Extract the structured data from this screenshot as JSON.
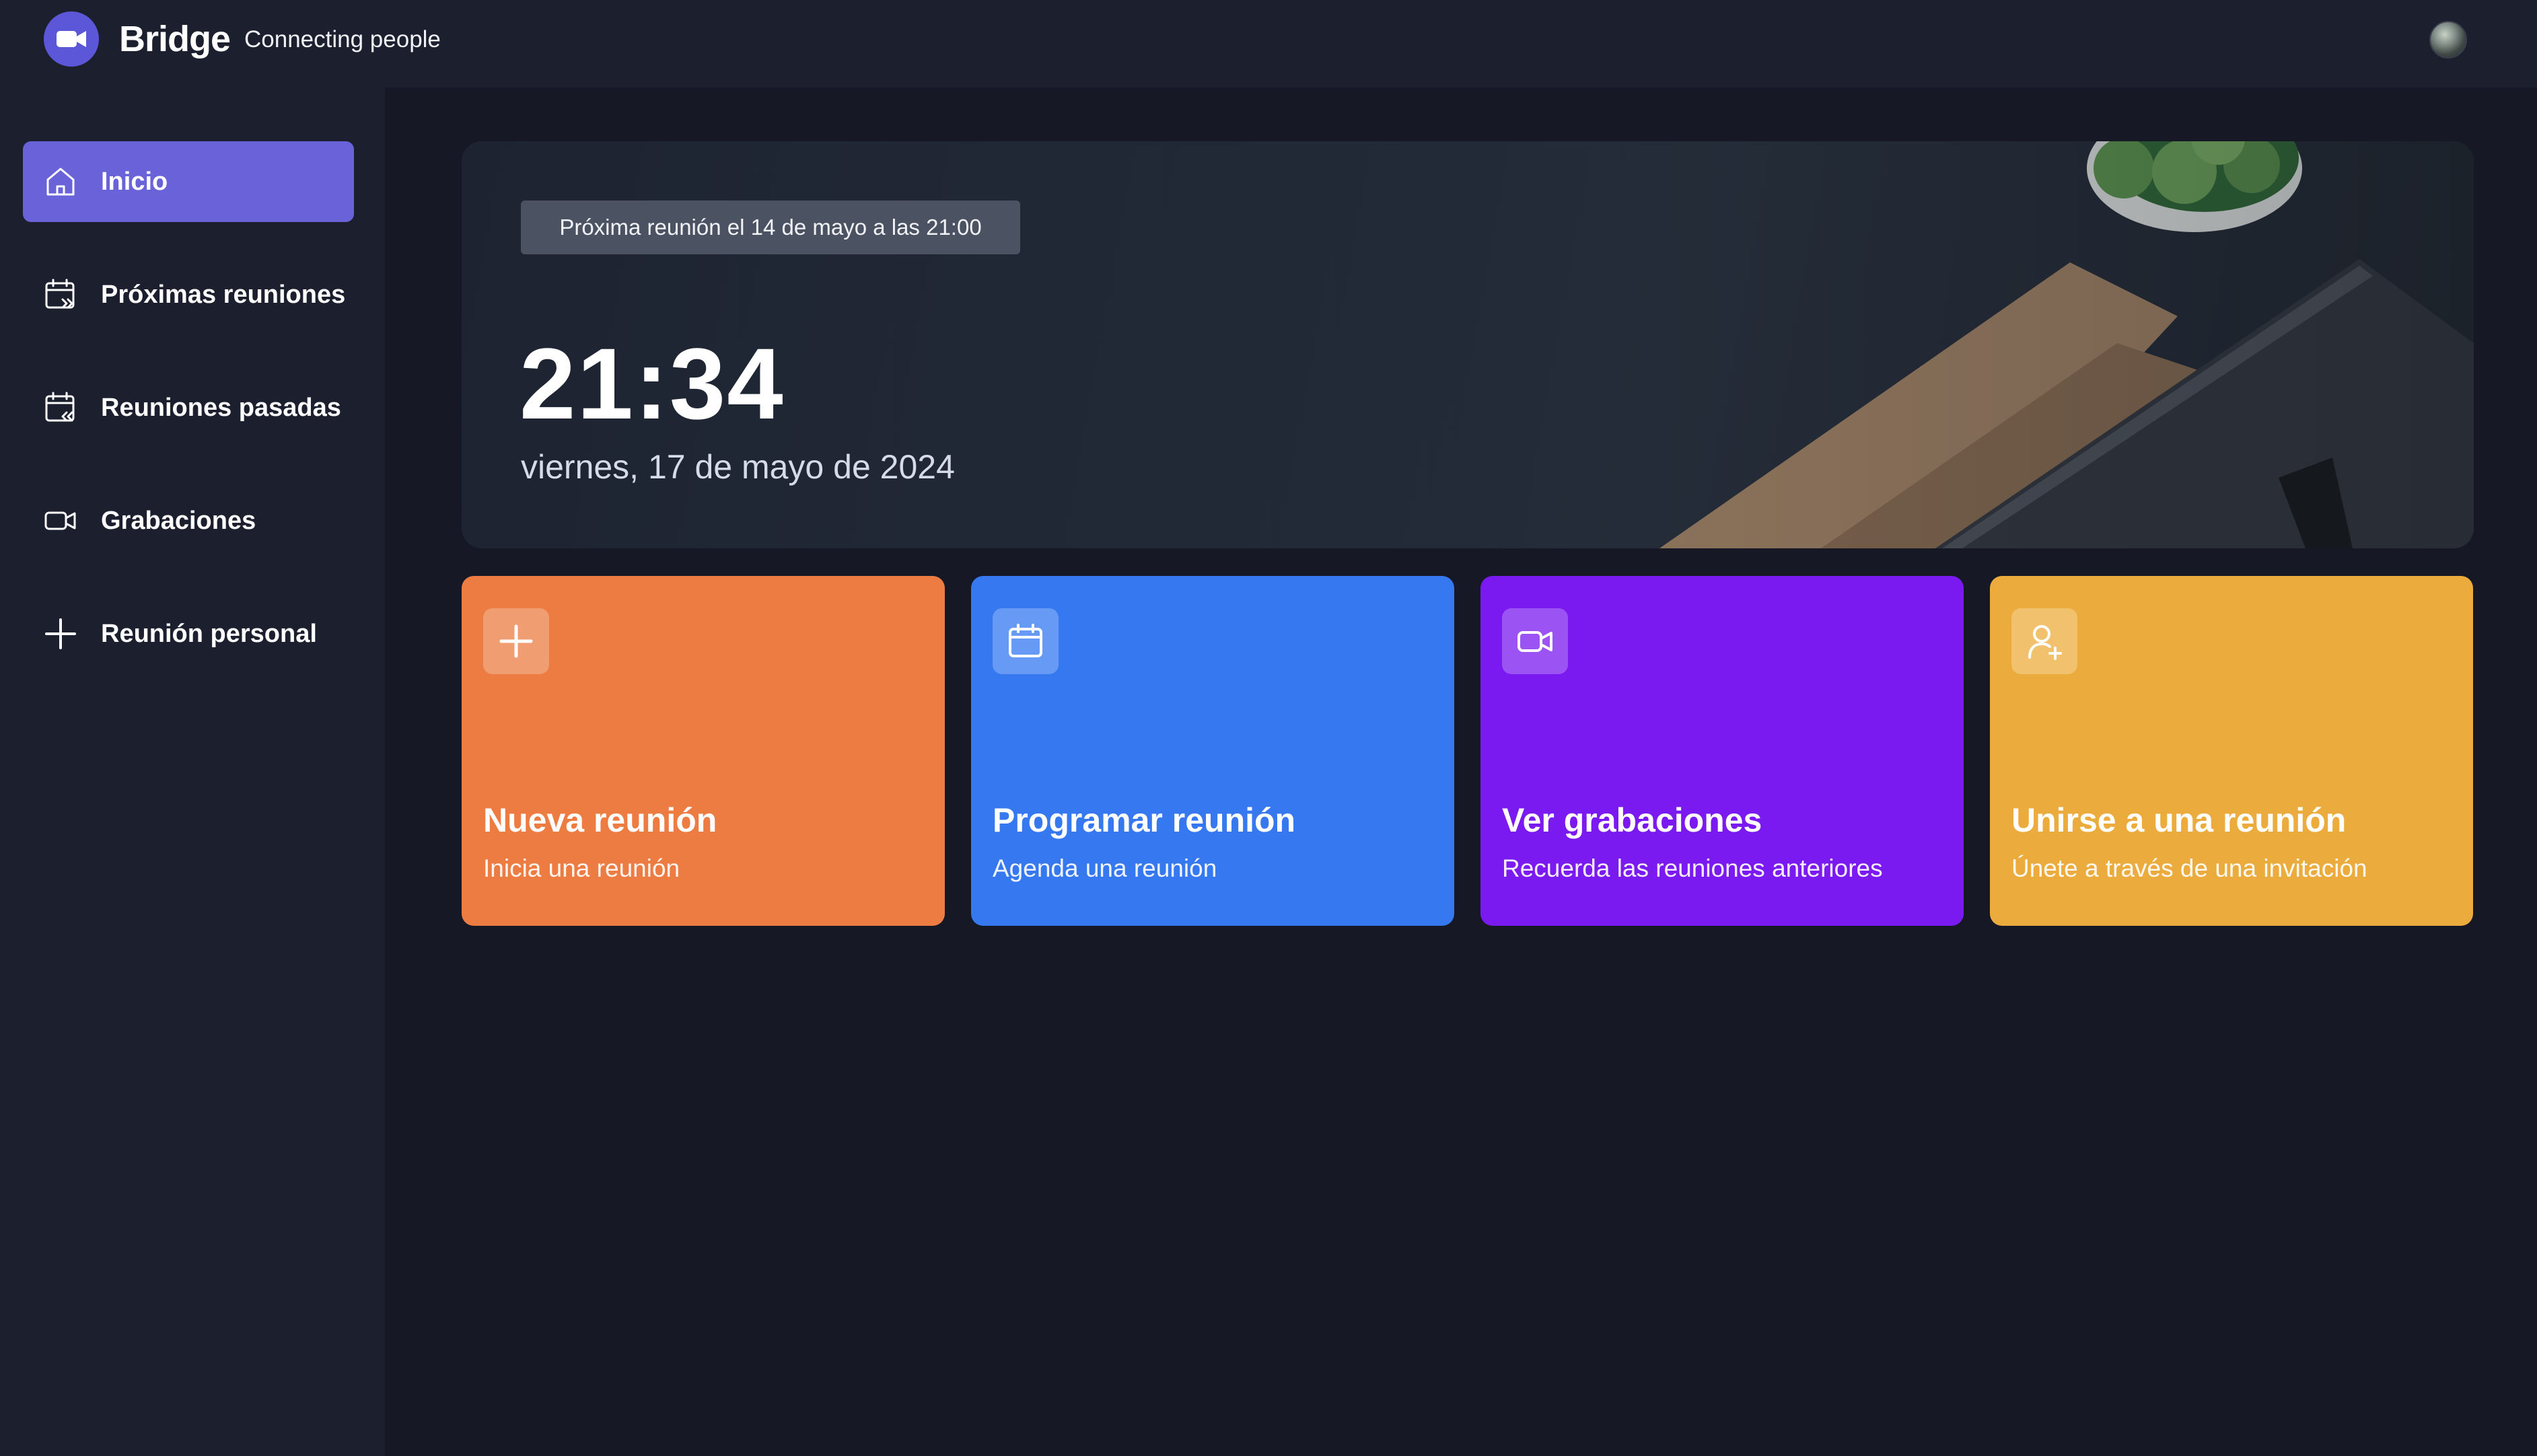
{
  "brand": {
    "name": "Bridge",
    "tagline": "Connecting people",
    "logo_icon": "video-camera-icon",
    "color": "#5b57d8"
  },
  "user": {
    "avatar_icon": "user-avatar"
  },
  "sidebar": {
    "items": [
      {
        "label": "Inicio",
        "icon": "home-icon",
        "active": true
      },
      {
        "label": "Próximas reuniones",
        "icon": "calendar-upcoming-icon",
        "active": false
      },
      {
        "label": "Reuniones pasadas",
        "icon": "calendar-past-icon",
        "active": false
      },
      {
        "label": "Grabaciones",
        "icon": "video-icon",
        "active": false
      },
      {
        "label": "Reunión personal",
        "icon": "plus-icon",
        "active": false
      }
    ],
    "active_color": "#6a62d8"
  },
  "hero": {
    "next_meeting": "Próxima reunión el 14 de mayo a las 21:00",
    "time": "21:34",
    "date": "viernes, 17 de mayo de 2024"
  },
  "cards": [
    {
      "title": "Nueva reunión",
      "subtitle": "Inicia una reunión",
      "icon": "plus-icon",
      "color": "#ed7c43"
    },
    {
      "title": "Programar reunión",
      "subtitle": "Agenda una reunión",
      "icon": "calendar-icon",
      "color": "#3578f0"
    },
    {
      "title": "Ver grabaciones",
      "subtitle": "Recuerda las reuniones anteriores",
      "icon": "video-icon",
      "color": "#7b1af0"
    },
    {
      "title": "Unirse a una reunión",
      "subtitle": "Únete a través de una invitación",
      "icon": "user-plus-icon",
      "color": "#ecac3d"
    }
  ]
}
